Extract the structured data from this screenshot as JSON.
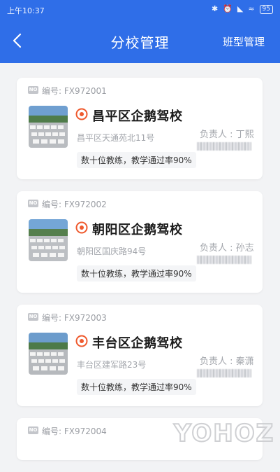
{
  "status_bar": {
    "time": "上午10:37",
    "icons": [
      "bluetooth-icon",
      "alarm-icon",
      "signal-icon",
      "wifi-icon"
    ],
    "battery": "95"
  },
  "header": {
    "title": "分校管理",
    "action_label": "班型管理",
    "background_color": "#2f6ee8"
  },
  "cards": [
    {
      "no": "编号: FX972001",
      "name": "昌平区企鹅驾校",
      "address": "昌平区天通苑北11号",
      "person_label": "负责人 : ",
      "person": "丁熙",
      "description": "数十位教练，教学通过率90%"
    },
    {
      "no": "编号: FX972002",
      "name": "朝阳区企鹅驾校",
      "address": "朝阳区国庆路94号",
      "person_label": "负责人 : ",
      "person": "孙志",
      "description": "数十位教练，教学通过率90%"
    },
    {
      "no": "编号: FX972003",
      "name": "丰台区企鹅驾校",
      "address": "丰台区建军路23号",
      "person_label": "负责人 : ",
      "person": "秦潇",
      "description": "数十位教练，教学通过率90%"
    },
    {
      "no": "编号: FX972004"
    }
  ],
  "badge_text": "NO",
  "watermark": "YOHOZ"
}
